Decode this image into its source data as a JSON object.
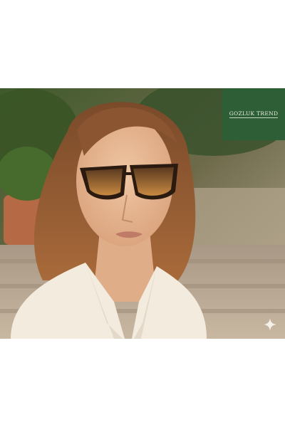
{
  "brand": {
    "name": "GOZLUK TREND",
    "box_color": "#2e5e35"
  },
  "photo": {
    "subject": "woman-wearing-tortoiseshell-cat-eye-sunglasses"
  },
  "icons": {
    "corner": "sparkle-icon"
  }
}
